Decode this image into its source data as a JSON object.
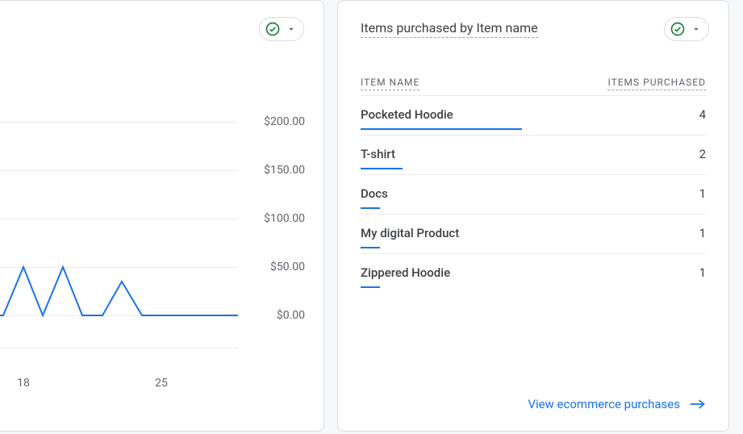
{
  "chart_data": {
    "type": "line",
    "x": [
      17,
      18,
      19,
      20,
      21,
      22,
      23,
      24,
      25,
      26,
      27,
      28,
      29
    ],
    "values": [
      0,
      50,
      0,
      50,
      0,
      0,
      35,
      0,
      0,
      0,
      0,
      0,
      0
    ],
    "ylim": [
      0,
      200
    ],
    "y_ticks": [
      200,
      150,
      100,
      50,
      0
    ],
    "y_tick_labels": [
      "$200.00",
      "$150.00",
      "$100.00",
      "$50.00",
      "$0.00"
    ],
    "x_tick_values": [
      18,
      25
    ],
    "x_tick_labels": [
      "18",
      "25"
    ],
    "xlabel": "",
    "ylabel": "",
    "title": ""
  },
  "left": {
    "y_labels": {
      "0": "$200.00",
      "1": "$150.00",
      "2": "$100.00",
      "3": "$50.00",
      "4": "$0.00"
    },
    "x_labels": {
      "0": "18",
      "1": "25"
    }
  },
  "right": {
    "title": "Items purchased by Item name",
    "columns": {
      "name": "ITEM NAME",
      "value": "ITEMS PURCHASED"
    },
    "max_value": 4,
    "rows": {
      "0": {
        "name": "Pocketed Hoodie",
        "value": "4",
        "pct": "100"
      },
      "1": {
        "name": "T-shirt",
        "value": "2",
        "pct": "26"
      },
      "2": {
        "name": "Docs",
        "value": "1",
        "pct": "12"
      },
      "3": {
        "name": "My digital Product",
        "value": "1",
        "pct": "12"
      },
      "4": {
        "name": "Zippered Hoodie",
        "value": "1",
        "pct": "12"
      }
    },
    "footer_link": "View ecommerce purchases"
  },
  "colors": {
    "accent": "#1a73e8",
    "check": "#188038",
    "text": "#3c4043",
    "muted": "#5f6368"
  }
}
